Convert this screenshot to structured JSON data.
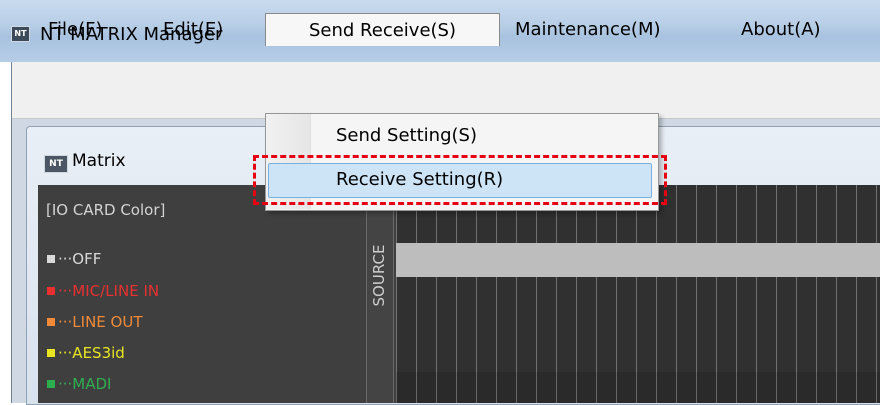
{
  "window": {
    "title": "NT MATRIX Manager",
    "icon_text": "NT"
  },
  "menubar": {
    "items": [
      {
        "label": "File(F)"
      },
      {
        "label": "Edit(E)"
      },
      {
        "label": "Send Receive(S)"
      },
      {
        "label": "Maintenance(M)"
      },
      {
        "label": "About(A)"
      }
    ]
  },
  "dropdown": {
    "items": [
      {
        "label": "Send Setting(S)"
      },
      {
        "label": "Receive Setting(R)"
      }
    ]
  },
  "child_window": {
    "title": "Matrix",
    "icon_text": "NT"
  },
  "legend": {
    "title": "[IO CARD Color]",
    "items": [
      {
        "label": "···OFF",
        "color": "#d9d9d9"
      },
      {
        "label": "···MIC/LINE IN",
        "color": "#e8302f"
      },
      {
        "label": "···LINE OUT",
        "color": "#f08a38"
      },
      {
        "label": "···AES3id",
        "color": "#e9e621"
      },
      {
        "label": "···MADI",
        "color": "#2fae4f"
      }
    ]
  },
  "matrix": {
    "source_label": "SOURCE"
  },
  "colors": {
    "callout": "#e60012",
    "highlight": "#cde4f7"
  }
}
